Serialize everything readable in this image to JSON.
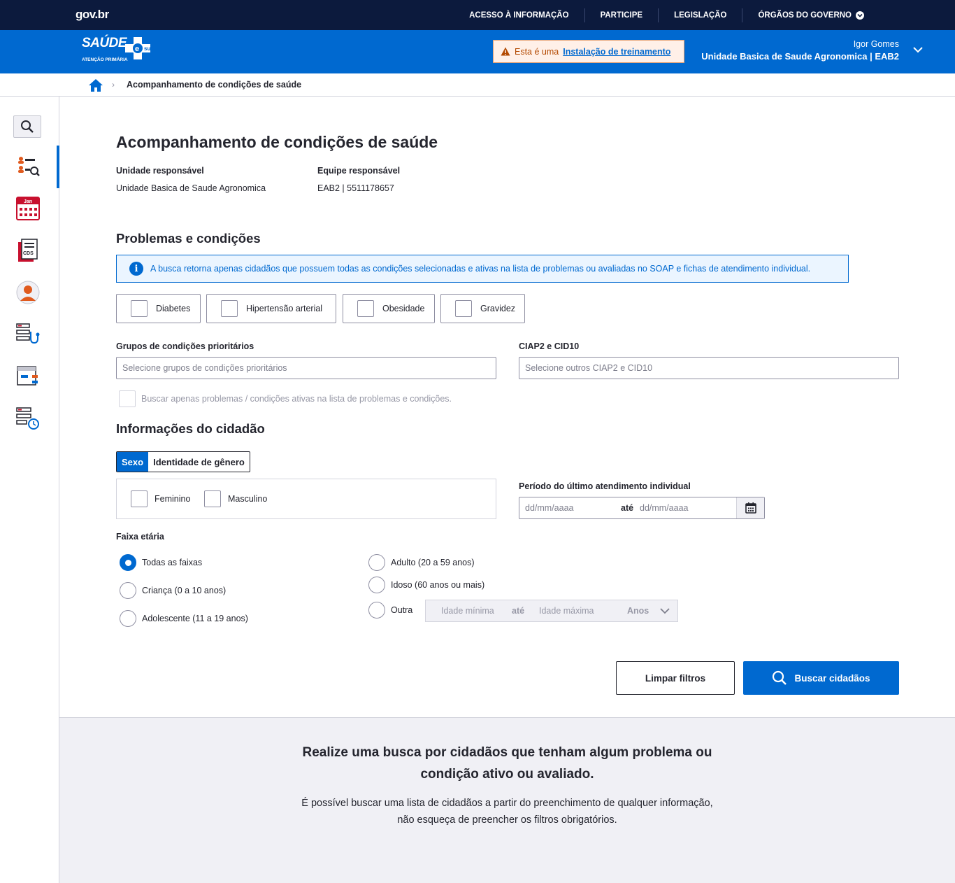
{
  "govbar": {
    "logo": "gov.br",
    "nav": [
      "ACESSO À INFORMAÇÃO",
      "PARTICIPE",
      "LEGISLAÇÃO",
      "ÓRGÃOS DO GOVERNO"
    ]
  },
  "header": {
    "logo_word": "SAÚDE",
    "logo_esus": "sus",
    "logo_sub": "ATENÇÃO PRIMÁRIA",
    "training_prefix": "Esta é uma",
    "training_link": "Instalação de treinamento",
    "user_name": "Igor Gomes",
    "user_unit": "Unidade Basica de Saude Agronomica | EAB2"
  },
  "breadcrumb": {
    "current": "Acompanhamento de condições de saúde"
  },
  "page": {
    "title": "Acompanhamento de condições de saúde",
    "unit_label": "Unidade responsável",
    "unit_value": "Unidade Basica de Saude Agronomica",
    "team_label": "Equipe responsável",
    "team_value": "EAB2 | 5511178657"
  },
  "problems": {
    "heading": "Problemas e condições",
    "info": "A busca retorna apenas cidadãos que possuem todas as condições selecionadas e ativas na lista de problemas ou avaliadas no SOAP e fichas de atendimento individual.",
    "conditions": [
      "Diabetes",
      "Hipertensão arterial",
      "Obesidade",
      "Gravidez"
    ],
    "groups_label": "Grupos de condições prioritários",
    "groups_placeholder": "Selecione grupos de condições prioritários",
    "ciap_label": "CIAP2 e CID10",
    "ciap_placeholder": "Selecione outros CIAP2 e CID10",
    "active_only_label": "Buscar apenas problemas / condições ativas na lista de problemas e condições."
  },
  "citizen": {
    "heading": "Informações do cidadão",
    "tab_sex": "Sexo",
    "tab_gender": "Identidade de gênero",
    "sex_options": [
      "Feminino",
      "Masculino"
    ],
    "period_label": "Período do último atendimento individual",
    "date_from": "dd/mm/aaaa",
    "date_sep": "até",
    "date_to": "dd/mm/aaaa",
    "age_label": "Faixa etária",
    "age_options": [
      "Todas as faixas",
      "Criança (0 a 10 anos)",
      "Adolescente (11 a 19 anos)",
      "Adulto (20 a 59 anos)",
      "Idoso (60 anos ou mais)",
      "Outra"
    ],
    "age_selected": "Todas as faixas",
    "age_min": "Idade mínima",
    "age_sep": "até",
    "age_max": "Idade máxima",
    "age_unit": "Anos"
  },
  "actions": {
    "clear": "Limpar filtros",
    "search": "Buscar cidadãos"
  },
  "empty_state": {
    "title_line1": "Realize uma busca por cidadãos que tenham algum problema ou",
    "title_line2": "condição ativo ou avaliado.",
    "desc_line1": "É possível buscar uma lista de cidadãos a partir do preenchimento de qualquer informação,",
    "desc_line2": "não esqueça de preencher os filtros obrigatórios."
  },
  "sidebar": {
    "icons": [
      "search-icon",
      "citizen-search-icon",
      "calendar-icon",
      "cds-icon",
      "profile-icon",
      "stethoscope-list-icon",
      "list-box-icon",
      "list-clock-icon"
    ],
    "calendar_text": "Jan",
    "cds_text": "CDS"
  },
  "colors": {
    "primary": "#0069d0",
    "govbar": "#0c1a3d",
    "warning": "#b34900"
  }
}
